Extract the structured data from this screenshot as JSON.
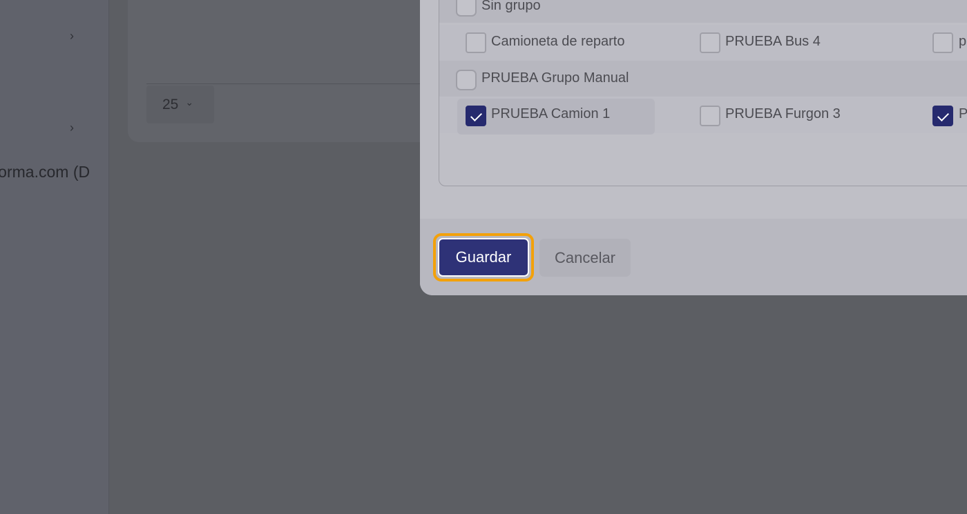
{
  "sidebar": {
    "partial_text": "nforma.com (D"
  },
  "table_pager": {
    "page_size": "25"
  },
  "vehicle_groups": [
    {
      "name": "Sin grupo",
      "checked": false,
      "vehicles": [
        {
          "name": "Camioneta de reparto",
          "checked": false
        },
        {
          "name": "PRUEBA Bus 4",
          "checked": false
        },
        {
          "name": "p",
          "checked": false
        }
      ]
    },
    {
      "name": "PRUEBA Grupo Manual",
      "checked": false,
      "vehicles": [
        {
          "name": "PRUEBA Camion 1",
          "checked": true
        },
        {
          "name": "PRUEBA Furgon 3",
          "checked": false
        },
        {
          "name": "P",
          "checked": true
        }
      ]
    }
  ],
  "footer": {
    "save_label": "Guardar",
    "cancel_label": "Cancelar"
  },
  "colors": {
    "primary": "#2e3277",
    "focus_ring": "#f3a10a",
    "checkbox_checked": "#262a6e"
  }
}
